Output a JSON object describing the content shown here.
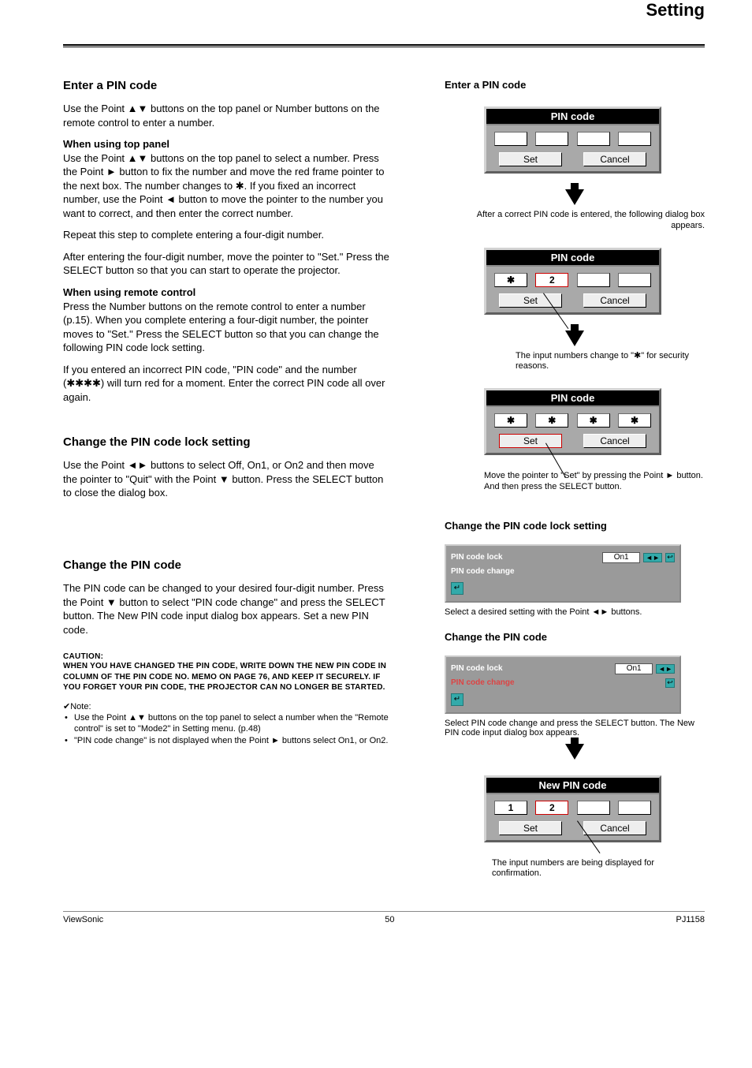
{
  "header": {
    "right_title": "Setting"
  },
  "left": {
    "h1": "Enter a PIN code",
    "p1": "Use the Point ▲▼ buttons on the top panel or Number buttons on the remote control to enter a number.",
    "p2_bold": "When using top panel",
    "p2": "Use the Point ▲▼ buttons on the top panel to select a number. Press the Point ► button to fix the number and move the red frame pointer to the next box. The number changes to ✱. If you fixed an incorrect number, use the Point ◄ button to move the pointer to the number you want to correct, and then enter the correct number.",
    "p3": "Repeat this step to complete entering a four-digit number.",
    "p4": "After entering the four-digit number, move the pointer to \"Set.\" Press the SELECT button so that you can start to operate the projector.",
    "p5_bold": "When using remote control",
    "p5": "Press the Number buttons on the remote control to enter a number (p.15). When you complete entering a four-digit number, the pointer moves to \"Set.\" Press the SELECT button so that you can change the following PIN code lock setting.",
    "p6": "If you entered an incorrect PIN code, \"PIN code\" and the number (✱✱✱✱) will turn red for a moment. Enter the correct PIN code all over again.",
    "h2": "Change the PIN code lock setting",
    "p7": "Use the Point ◄► buttons to select Off, On1, or On2 and then move the pointer to \"Quit\" with the Point ▼ button. Press the SELECT button to close the dialog box.",
    "h3": "Change the PIN code",
    "p8": "The PIN code can be changed to your desired four-digit number. Press the Point ▼ button to select \"PIN code change\" and press the SELECT button. The New PIN code input dialog box appears. Set a new PIN code.",
    "caution_head": "CAUTION:",
    "caution": "WHEN YOU HAVE CHANGED THE PIN CODE, WRITE DOWN THE NEW PIN CODE IN COLUMN OF THE PIN CODE NO. MEMO ON PAGE 76, AND KEEP IT SECURELY. IF YOU FORGET YOUR PIN CODE, THE PROJECTOR CAN NO LONGER BE STARTED.",
    "note_head": "✔Note:",
    "note1": "Use the Point ▲▼ buttons on the top panel to select a number when the \"Remote control\" is set to \"Mode2\" in Setting menu. (p.48)",
    "note2": "\"PIN code change\" is not displayed when the Point ► buttons select On1, or On2."
  },
  "right": {
    "head1": "Enter a PIN code",
    "dlg_title_pin": "PIN code",
    "dlg_title_new": "New PIN code",
    "set": "Set",
    "cancel": "Cancel",
    "callout1": "After a correct PIN code is entered, the following dialog box appears.",
    "callout2": "The input numbers change to \"✱\" for security reasons.",
    "callout3": "Move the pointer to \"Set\" by pressing the Point ► button. And then press the SELECT button.",
    "head2": "Change the PIN code lock setting",
    "menu_lock": "PIN code lock",
    "menu_change": "PIN code change",
    "menu_val": "On1",
    "right_note1": "Select a desired setting with the Point ◄► buttons.",
    "head3": "Change the PIN code",
    "right_note2": "Select PIN code change and press the SELECT button. The New PIN code input dialog box appears.",
    "callout4": "The input numbers are being displayed for confirmation."
  },
  "digits": {
    "blank": "",
    "star": "✱",
    "two": "2",
    "one": "1"
  },
  "footer": {
    "left": "ViewSonic",
    "center": "50",
    "right": "PJ1158"
  }
}
